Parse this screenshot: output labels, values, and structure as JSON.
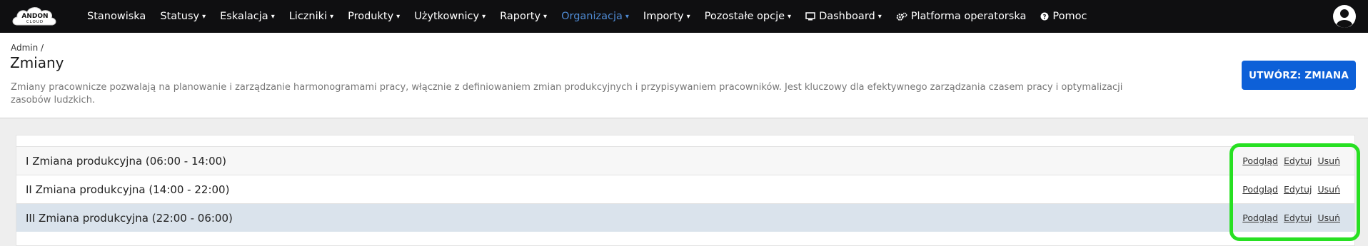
{
  "navbar": {
    "logo_text": "ANDON CLOUD",
    "items": [
      {
        "label": "Stanowiska",
        "caret": false,
        "active": false
      },
      {
        "label": "Statusy",
        "caret": true,
        "active": false
      },
      {
        "label": "Eskalacja",
        "caret": true,
        "active": false
      },
      {
        "label": "Liczniki",
        "caret": true,
        "active": false
      },
      {
        "label": "Produkty",
        "caret": true,
        "active": false
      },
      {
        "label": "Użytkownicy",
        "caret": true,
        "active": false
      },
      {
        "label": "Raporty",
        "caret": true,
        "active": false
      },
      {
        "label": "Organizacja",
        "caret": true,
        "active": true
      },
      {
        "label": "Importy",
        "caret": true,
        "active": false
      },
      {
        "label": "Pozostałe opcje",
        "caret": true,
        "active": false
      },
      {
        "label": "Dashboard",
        "caret": true,
        "active": false,
        "icon": "monitor-icon"
      },
      {
        "label": "Platforma operatorska",
        "caret": false,
        "active": false,
        "icon": "cogs-icon"
      },
      {
        "label": "Pomoc",
        "caret": false,
        "active": false,
        "icon": "question-circle-icon"
      }
    ],
    "caret_glyph": "▾",
    "user_icon": "user-circle-icon",
    "active_color": "#4f8bd4"
  },
  "header": {
    "breadcrumb": "Admin /",
    "title": "Zmiany",
    "description": "Zmiany pracownicze pozwalają na planowanie i zarządzanie harmonogramami pracy, włącznie z definiowaniem zmian produkcyjnych i przypisywaniem pracowników. Jest kluczowy dla efektywnego zarządzania czasem pracy i optymalizacji zasobów ludzkich.",
    "create_button": "UTWÓRZ: ZMIANA",
    "create_button_color": "#0d60d8"
  },
  "shifts": [
    {
      "name": "I Zmiana produkcyjna (06:00 - 14:00)",
      "background": "#f7f7f7"
    },
    {
      "name": "II Zmiana produkcyjna (14:00 - 22:00)",
      "background": "#ffffff"
    },
    {
      "name": "III Zmiana produkcyjna (22:00 - 06:00)",
      "background": "#dae3ec"
    }
  ],
  "row_actions": {
    "view": "Podgląd",
    "edit": "Edytuj",
    "delete": "Usuń"
  },
  "highlight_color": "#27e022"
}
